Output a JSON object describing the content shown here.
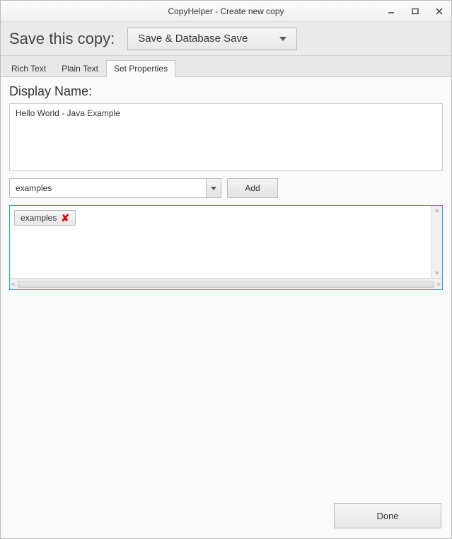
{
  "window": {
    "title": "CopyHelper - Create new copy"
  },
  "strip": {
    "label": "Save this copy:",
    "save_mode": "Save & Database Save"
  },
  "tabs": {
    "rich": "Rich Text",
    "plain": "Plain Text",
    "props": "Set Properties",
    "active": "props"
  },
  "props": {
    "display_name_label": "Display Name:",
    "display_name_value": "Hello World - Java Example",
    "combo_value": "examples",
    "add_label": "Add",
    "tags": [
      "examples"
    ]
  },
  "footer": {
    "done_label": "Done"
  }
}
